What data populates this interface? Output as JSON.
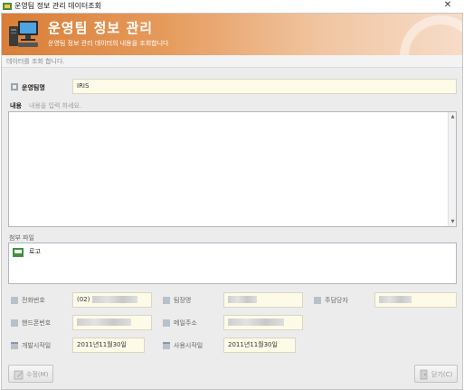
{
  "window": {
    "title": "운영팀 정보 관리 데이터조회",
    "close_glyph": "✕"
  },
  "banner": {
    "title": "운영팀 정보 관리",
    "subtitle": "운영팀 정보 관리 데이터의 내용을 조회합니다",
    "accent": "#d97e38"
  },
  "status": {
    "text": "데이터를 조회 합니다."
  },
  "team": {
    "label": "운영팀명",
    "value": "IRIS"
  },
  "content": {
    "label": "내용",
    "placeholder": "내용을 입력 하세요."
  },
  "attachment": {
    "label": "첨부 파일",
    "file_name": "로고"
  },
  "details": {
    "phone": {
      "label": "전화번호",
      "value": "(02)"
    },
    "team_lead": {
      "label": "팀장명",
      "value": ""
    },
    "main_contact": {
      "label": "주담당자",
      "value": ""
    },
    "mobile": {
      "label": "핸드폰번호",
      "value": ""
    },
    "email": {
      "label": "메일주소",
      "value": ""
    },
    "dev_start": {
      "label": "개발시작일",
      "value": "2011년11월30일"
    },
    "use_start": {
      "label": "사용시작일",
      "value": "2011년11월30일"
    }
  },
  "buttons": {
    "edit": "수정(M)",
    "close": "닫기(C)"
  }
}
